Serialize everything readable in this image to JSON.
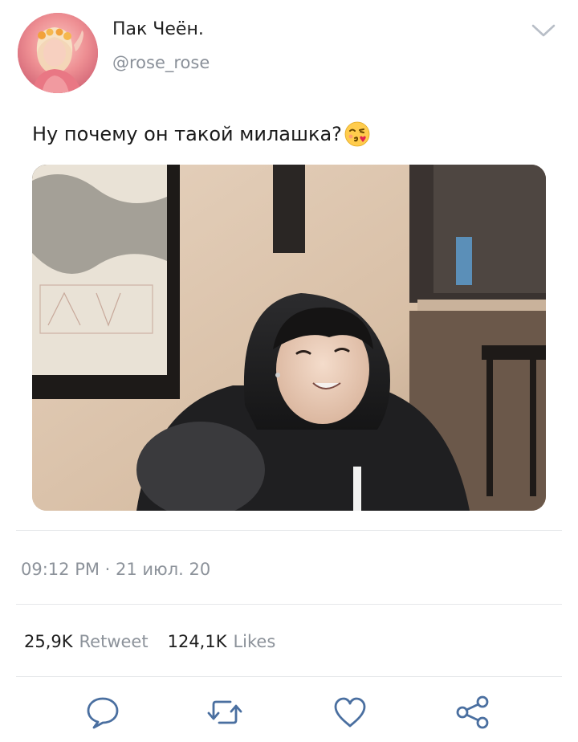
{
  "tweet": {
    "author": {
      "display_name": "Пак Чеён.",
      "handle": "@rose_rose"
    },
    "text": "Ну почему он такой милашка?",
    "emoji": "face-blowing-kiss-icon",
    "timestamp": "09:12 PM · 21 июл. 20",
    "stats": {
      "retweets_count": "25,9K",
      "retweets_label": "Retweet",
      "likes_count": "124,1K",
      "likes_label": "Likes"
    },
    "actions": {
      "reply": "comment-icon",
      "retweet": "retweet-icon",
      "like": "heart-icon",
      "share": "share-icon"
    }
  },
  "colors": {
    "text": "#1b1b1b",
    "muted": "#8c929a",
    "divider": "#e6e8eb",
    "icon": "#4a6fa0"
  }
}
